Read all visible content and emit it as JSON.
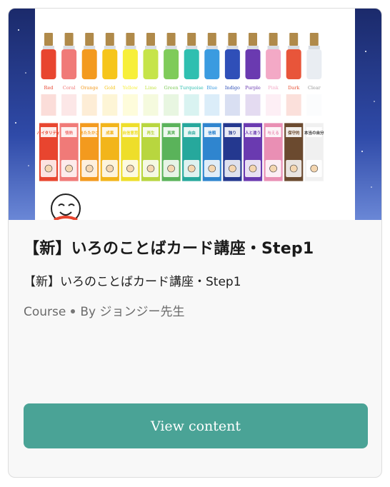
{
  "card": {
    "title": "【新】いろのことばカード講座・Step1",
    "subtitle": "【新】いろのことばカード講座・Step1",
    "meta": {
      "type": "Course",
      "author": "By ジョンジー先生"
    },
    "button_label": "View content"
  },
  "thumbnail": {
    "bottles": [
      {
        "label": "Red",
        "color": "#e8452f"
      },
      {
        "label": "Coral",
        "color": "#f07a78"
      },
      {
        "label": "Orange",
        "color": "#f39a1e"
      },
      {
        "label": "Gold",
        "color": "#f6c51a"
      },
      {
        "label": "Yellow",
        "color": "#f7ef3a"
      },
      {
        "label": "Lime",
        "color": "#c6e449"
      },
      {
        "label": "Green",
        "color": "#7fcb5a"
      },
      {
        "label": "Turquoise",
        "color": "#2fbfb0"
      },
      {
        "label": "Blue",
        "color": "#3a9be0"
      },
      {
        "label": "Indigo",
        "color": "#2f4fb8"
      },
      {
        "label": "Purple",
        "color": "#6a3ab0"
      },
      {
        "label": "Pink",
        "color": "#f3a9c6"
      },
      {
        "label": "Dark",
        "color": "#e8553a"
      },
      {
        "label": "Clear",
        "color": "#e9edf2"
      }
    ],
    "cards": [
      {
        "word": "バイタリティ",
        "color": "#e8452f"
      },
      {
        "word": "情熱",
        "color": "#f07a78"
      },
      {
        "word": "あたたかさ",
        "color": "#f39a1e"
      },
      {
        "word": "成果",
        "color": "#f2b51a"
      },
      {
        "word": "自信意思",
        "color": "#eede2a"
      },
      {
        "word": "再生",
        "color": "#b8d63f"
      },
      {
        "word": "真実",
        "color": "#5ab35a"
      },
      {
        "word": "自由",
        "color": "#26a89c"
      },
      {
        "word": "信頼",
        "color": "#2f85cf"
      },
      {
        "word": "独り",
        "color": "#24388f"
      },
      {
        "word": "人と違う",
        "color": "#6a3ab0"
      },
      {
        "word": "与える",
        "color": "#e98fb4"
      },
      {
        "word": "保守的",
        "color": "#6b4a2f"
      },
      {
        "word": "本当の自分",
        "color": "#f0f0f0"
      }
    ]
  }
}
